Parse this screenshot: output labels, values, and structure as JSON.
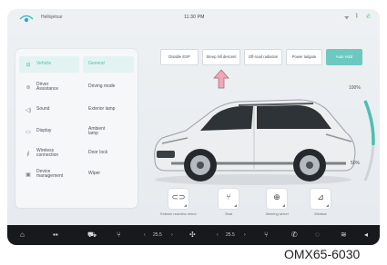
{
  "status_bar": {
    "app_name": "Hellojetour",
    "time": "11:30 PM",
    "icons": [
      "wifi-icon",
      "bluetooth-icon",
      "phone-icon"
    ]
  },
  "sidebar": {
    "items": [
      {
        "label": "Vehicle",
        "icon": "car-icon",
        "active": true
      },
      {
        "label": "Driver Assistance",
        "icon": "steering-assist-icon",
        "active": false
      },
      {
        "label": "Sound",
        "icon": "speaker-icon",
        "active": false
      },
      {
        "label": "Display",
        "icon": "display-icon",
        "active": false
      },
      {
        "label": "Wireless connection",
        "icon": "wireless-icon",
        "active": false
      },
      {
        "label": "Device management",
        "icon": "device-icon",
        "active": false
      }
    ],
    "sub_items": [
      {
        "label": "General",
        "active": true
      },
      {
        "label": "Driving mode",
        "active": false
      },
      {
        "label": "Exterior lamp",
        "active": false
      },
      {
        "label": "Ambient lamp",
        "active": false
      },
      {
        "label": "Door lock",
        "active": false
      },
      {
        "label": "Wiper",
        "active": false
      }
    ]
  },
  "quick_buttons": [
    {
      "label": "Disable ESP",
      "active": false
    },
    {
      "label": "Steep hill descent",
      "active": false
    },
    {
      "label": "Off-road radiation",
      "active": false
    },
    {
      "label": "Power tailgate",
      "active": false
    },
    {
      "label": "Auto Hold",
      "active": true
    }
  ],
  "gauge": {
    "top_label": "100%",
    "bottom_label": "50%",
    "level": 0.5
  },
  "controls": [
    {
      "label": "Exterior rearview mirror",
      "icon": "mirror-icon"
    },
    {
      "label": "Seat",
      "icon": "seat-icon"
    },
    {
      "label": "Steering wheel",
      "icon": "steering-wheel-icon"
    },
    {
      "label": "Window",
      "icon": "window-icon"
    }
  ],
  "dock": {
    "left_temp": "25.5",
    "right_temp": "25.5",
    "items": [
      "home-icon",
      "apps-icon",
      "car-icon",
      "seat-heat-icon",
      "fan-icon",
      "seat-heat-right-icon",
      "phone-icon",
      "climate-icon",
      "volume-icon"
    ]
  },
  "footer_code": "OMX65-6030",
  "colors": {
    "accent": "#4cbfb2",
    "accent_button": "#6cc9c0",
    "dock": "#17191c",
    "arrow": "#f4a6b8",
    "car_body": "#eceeef"
  }
}
